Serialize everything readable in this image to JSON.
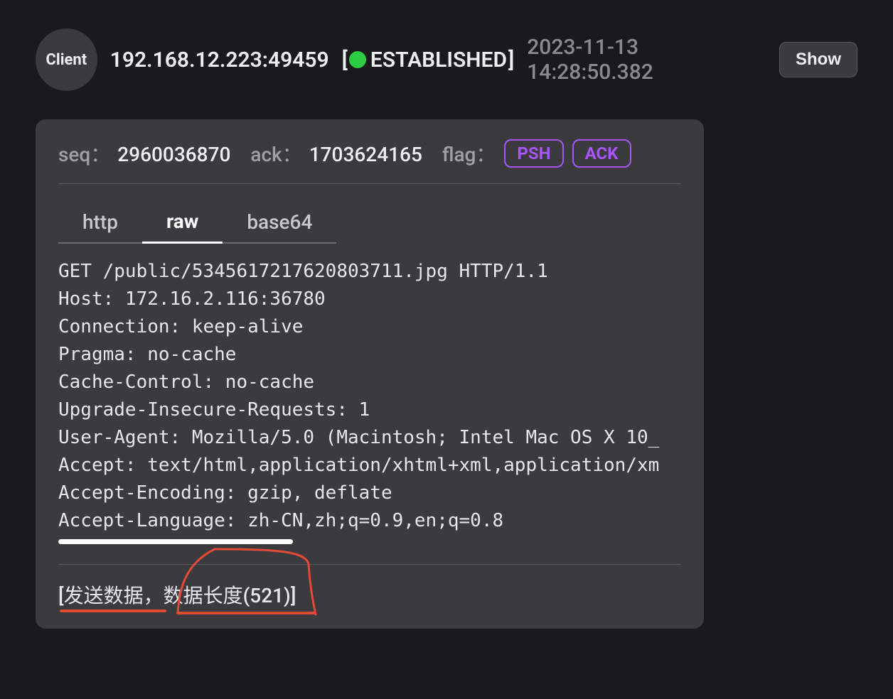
{
  "header": {
    "clientLabel": "Client",
    "address": "192.168.12.223:49459",
    "statusText": "ESTABLISHED",
    "timestamp": "2023-11-13 14:28:50.382",
    "showButton": "Show"
  },
  "tcp": {
    "seqLabel": "seq：",
    "seqValue": "2960036870",
    "ackLabel": "ack：",
    "ackValue": "1703624165",
    "flagLabel": "flag：",
    "flags": [
      "PSH",
      "ACK"
    ]
  },
  "tabs": [
    {
      "label": "http",
      "active": false
    },
    {
      "label": "raw",
      "active": true
    },
    {
      "label": "base64",
      "active": false
    }
  ],
  "payload": {
    "lines": [
      "GET /public/5345617217620803711.jpg HTTP/1.1",
      "Host: 172.16.2.116:36780",
      "Connection: keep-alive",
      "Pragma: no-cache",
      "Cache-Control: no-cache",
      "Upgrade-Insecure-Requests: 1",
      "User-Agent: Mozilla/5.0 (Macintosh; Intel Mac OS X 10_",
      "Accept: text/html,application/xhtml+xml,application/xm",
      "Accept-Encoding: gzip, deflate",
      "Accept-Language: zh-CN,zh;q=0.9,en;q=0.8"
    ]
  },
  "footer": {
    "statusText": "[发送数据，数据长度(521)]"
  }
}
